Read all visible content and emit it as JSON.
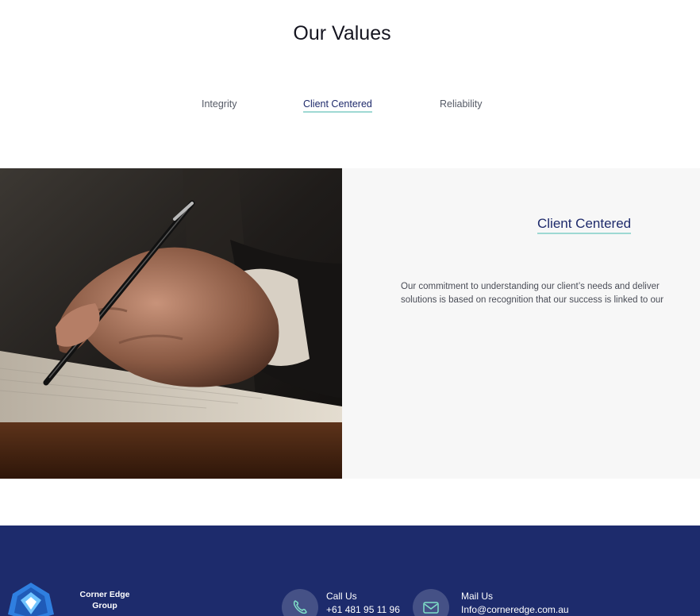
{
  "section": {
    "title": "Our Values"
  },
  "tabs": [
    {
      "label": "Integrity",
      "active": false
    },
    {
      "label": "Client Centered",
      "active": true
    },
    {
      "label": "Reliability",
      "active": false
    }
  ],
  "panel": {
    "title": "Client Centered",
    "line1": "Our commitment to understanding our client’s needs and deliver",
    "line2": "solutions is based on recognition that our success is linked to our"
  },
  "footer": {
    "brand_line1": "Corner Edge",
    "brand_line2": "Group",
    "call_label": "Call Us",
    "call_value": "+61 481 95 11 96",
    "mail_label": "Mail Us",
    "mail_value": "Info@corneredge.com.au"
  },
  "colors": {
    "accent": "#9ed9d3",
    "navy": "#1d2b6c",
    "panel_bg": "#f7f7f7"
  },
  "icons": {
    "call": "phone-icon",
    "mail": "mail-icon",
    "logo": "corner-edge-logo"
  }
}
